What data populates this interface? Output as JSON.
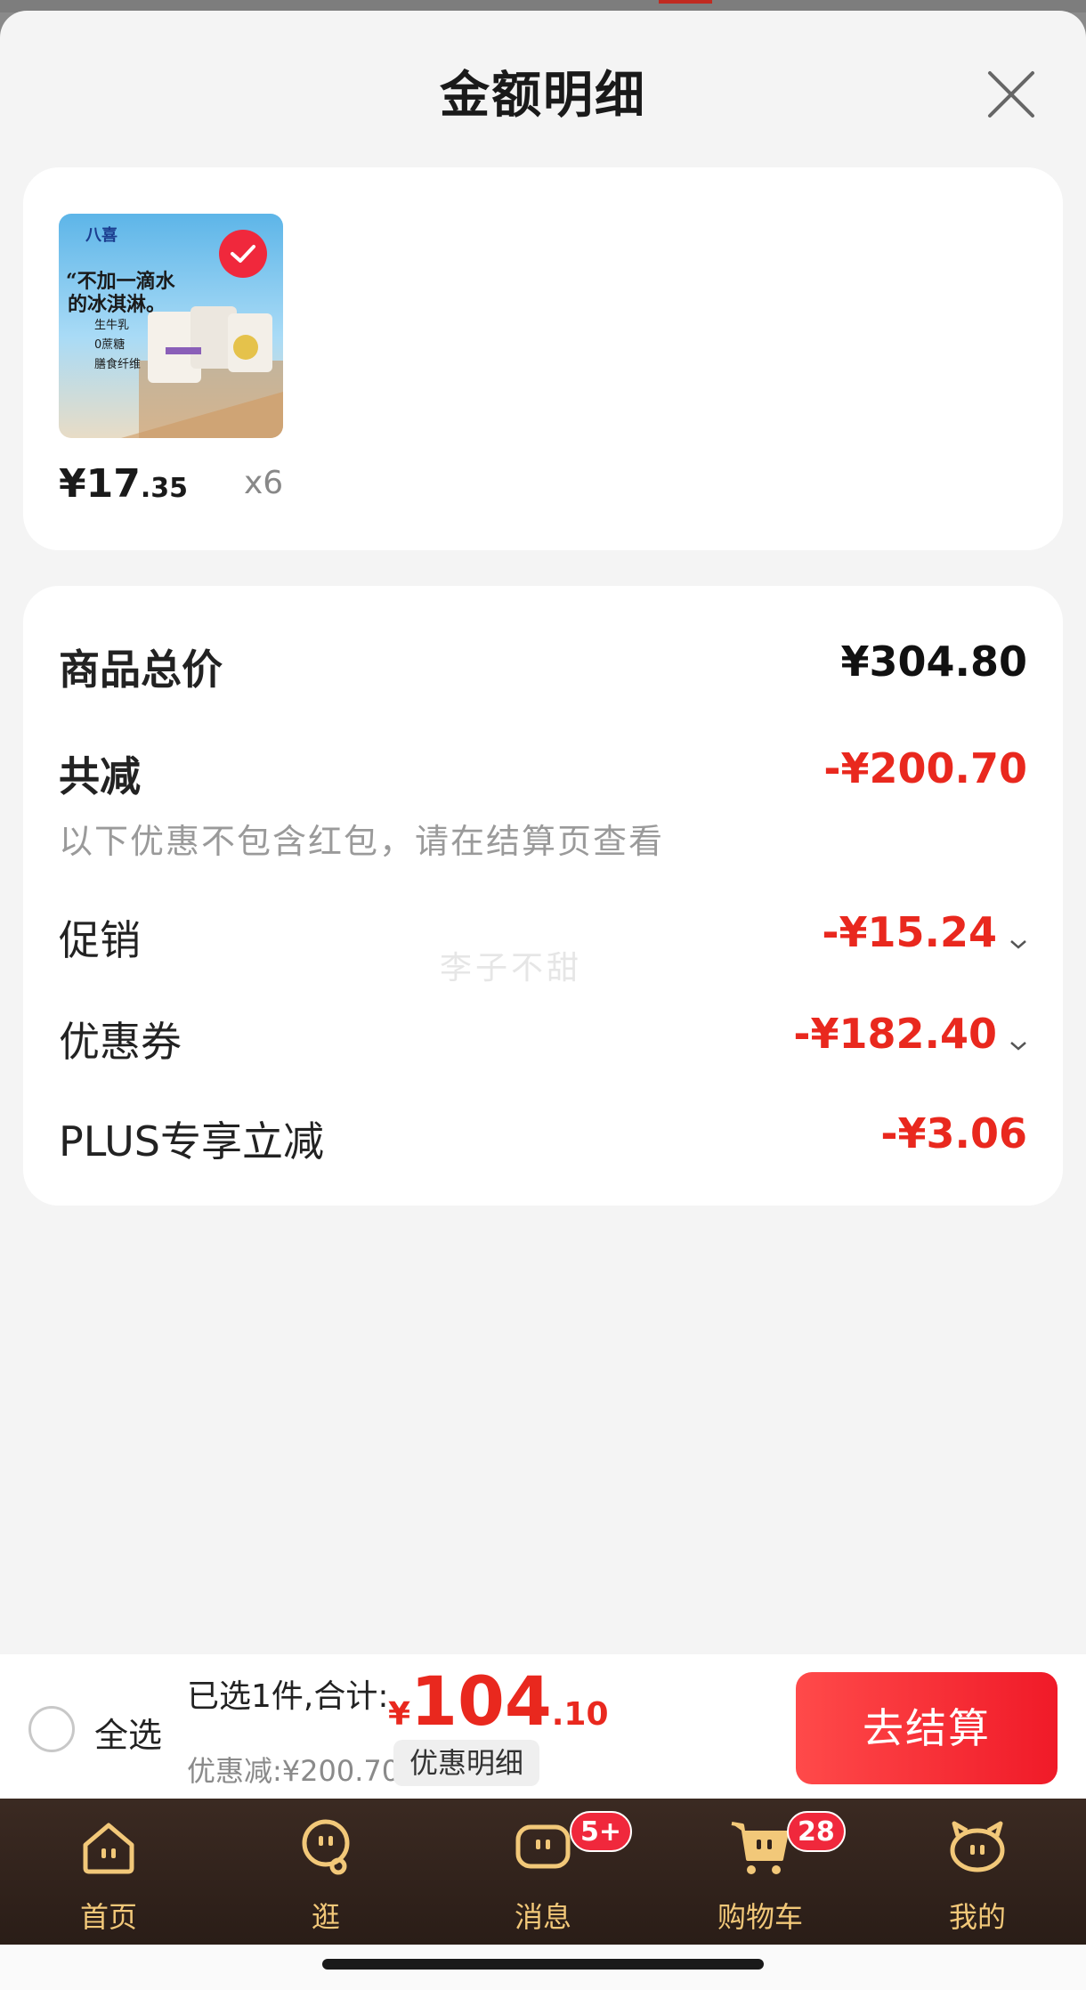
{
  "sheet": {
    "title": "金额明细",
    "close_icon": "close-icon"
  },
  "product": {
    "brand_text": "八喜",
    "image_caption_line1": "“不加一滴水",
    "image_caption_line2": "的冰淇淋。",
    "image_bullets": [
      "生牛乳",
      "0蔗糖",
      "膳食纤维"
    ],
    "price_int": "¥17",
    "price_dec": ".35",
    "quantity": "x6",
    "selected": true
  },
  "summary": {
    "total_label": "商品总价",
    "total_value": "¥304.80",
    "discount_label": "共减",
    "discount_value": "-¥200.70",
    "discount_note": "以下优惠不包含红包，请在结算页查看",
    "watermark": "李子不甜",
    "rows": [
      {
        "label": "促销",
        "value": "-¥15.24",
        "expandable": true
      },
      {
        "label": "优惠券",
        "value": "-¥182.40",
        "expandable": true
      },
      {
        "label": "PLUS专享立减",
        "value": "-¥3.06",
        "expandable": false
      }
    ]
  },
  "bottom_bar": {
    "select_all": "全选",
    "selected_text": "已选1件,合计:",
    "total_symbol": "¥",
    "total_int": "104",
    "total_dec": ".10",
    "saved_text": "优惠减:¥200.70",
    "detail_button": "优惠明细",
    "checkout_button": "去结算"
  },
  "tabbar": {
    "tabs": [
      {
        "label": "首页",
        "icon": "home-icon",
        "badge": ""
      },
      {
        "label": "逛",
        "icon": "browse-icon",
        "badge": ""
      },
      {
        "label": "消息",
        "icon": "message-icon",
        "badge": "5+"
      },
      {
        "label": "购物车",
        "icon": "cart-icon",
        "badge": "28"
      },
      {
        "label": "我的",
        "icon": "profile-icon",
        "badge": ""
      }
    ]
  },
  "colors": {
    "accent_red": "#e9281e",
    "tab_gold": "#f2c879",
    "tabbar_bg": "#2f211a"
  }
}
